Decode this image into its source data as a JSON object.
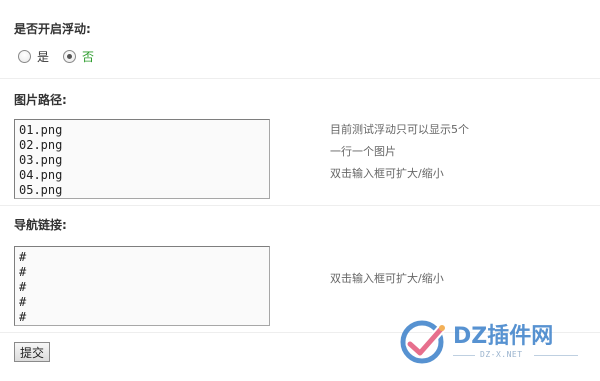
{
  "float_section": {
    "title": "是否开启浮动:",
    "options": [
      {
        "label": "是",
        "checked": false
      },
      {
        "label": "否",
        "checked": true
      }
    ]
  },
  "image_path_section": {
    "title": "图片路径:",
    "value": "01.png\n02.png\n03.png\n04.png\n05.png",
    "hints": [
      "目前测试浮动只可以显示5个",
      "一行一个图片",
      "双击输入框可扩大/缩小"
    ]
  },
  "nav_link_section": {
    "title": "导航链接:",
    "value": "#\n#\n#\n#\n#",
    "hints": [
      "双击输入框可扩大/缩小"
    ]
  },
  "submit_label": "提交",
  "watermark": {
    "logo_text": "DZ插件网",
    "sub_text": "DZ-X.NET"
  },
  "colors": {
    "selected_option": "#2a9b2a",
    "hint_text": "#666666",
    "watermark": "#3a80c9"
  }
}
